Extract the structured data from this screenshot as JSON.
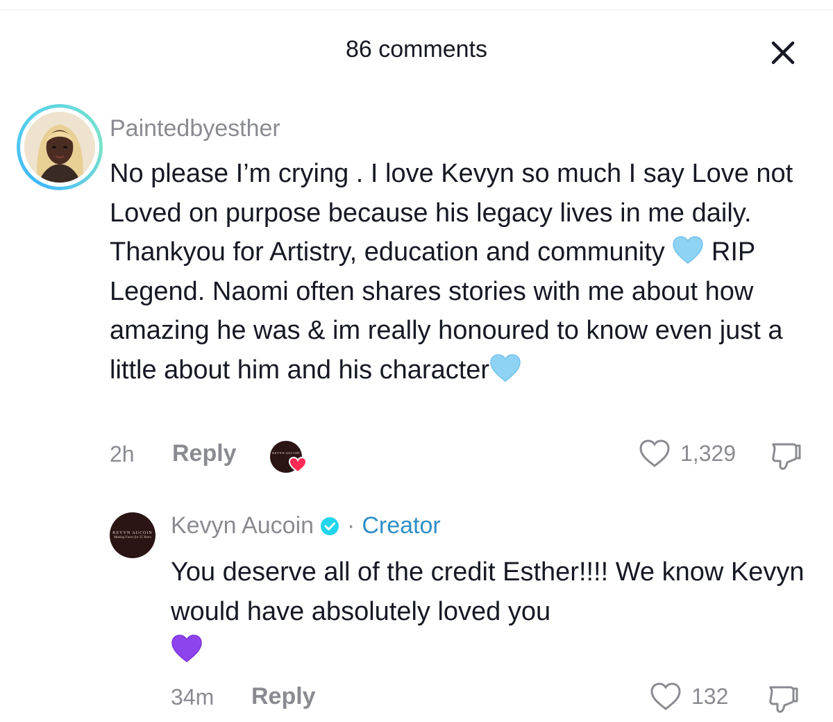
{
  "header": {
    "title": "86 comments"
  },
  "comments": [
    {
      "username": "Paintedbyesther",
      "text_parts": [
        "No please I’m crying . I love Kevyn so much I say Love not Loved on purpose because his legacy lives in me daily. Thankyou for Artistry, education and community ",
        " RIP Legend. Naomi often shares stories with me about how amazing he was & im really honoured to know even just a little about him and his character"
      ],
      "emoji": "light-blue-heart",
      "time": "2h",
      "reply_label": "Reply",
      "likes": "1,329",
      "creator_logo_text": "KEVYN AUCOIN"
    },
    {
      "username": "Kevyn Aucoin",
      "separator": "·",
      "badge": "Creator",
      "text": "You deserve all of the credit Esther!!!! We know Kevyn would have absolutely loved you",
      "emoji": "purple-heart",
      "time": "34m",
      "reply_label": "Reply",
      "likes": "132",
      "avatar_text_1": "KEVYN AUCOIN",
      "avatar_text_2": "Making Faces for 25 Years"
    }
  ],
  "colors": {
    "text_primary": "#161823",
    "text_secondary": "#8a8b91",
    "creator_blue": "#2e8fc6",
    "heart_light_blue": "#8fd3f4",
    "heart_purple": "#8e44ec",
    "liked_red": "#fe2c55"
  }
}
